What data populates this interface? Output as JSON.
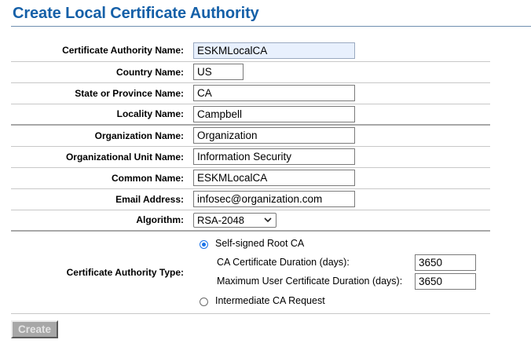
{
  "page": {
    "title": "Create Local Certificate Authority"
  },
  "form": {
    "ca_name": {
      "label": "Certificate Authority Name:",
      "value": "ESKMLocalCA"
    },
    "country": {
      "label": "Country Name:",
      "value": "US"
    },
    "state": {
      "label": "State or Province Name:",
      "value": "CA"
    },
    "locality": {
      "label": "Locality Name:",
      "value": "Campbell"
    },
    "organization": {
      "label": "Organization Name:",
      "value": "Organization"
    },
    "org_unit": {
      "label": "Organizational Unit Name:",
      "value": "Information Security"
    },
    "common_name": {
      "label": "Common Name:",
      "value": "ESKMLocalCA"
    },
    "email": {
      "label": "Email Address:",
      "value": "infosec@organization.com"
    },
    "algorithm": {
      "label": "Algorithm:",
      "selected": "RSA-2048"
    },
    "ca_type": {
      "label": "Certificate Authority Type:",
      "self_signed": {
        "label": "Self-signed Root CA",
        "checked": true
      },
      "ca_duration": {
        "label": "CA Certificate Duration (days):",
        "value": "3650"
      },
      "user_duration": {
        "label": "Maximum User Certificate Duration (days):",
        "value": "3650"
      },
      "intermediate": {
        "label": "Intermediate CA Request",
        "checked": false
      }
    }
  },
  "actions": {
    "create_label": "Create"
  },
  "colors": {
    "title": "#1560a8",
    "radio_selected": "#1a73e8",
    "focused_input_bg": "#e8f0fd",
    "button_disabled_bg": "#a7a7a7"
  },
  "icons": {
    "select_arrow": "chevron-down-icon"
  }
}
